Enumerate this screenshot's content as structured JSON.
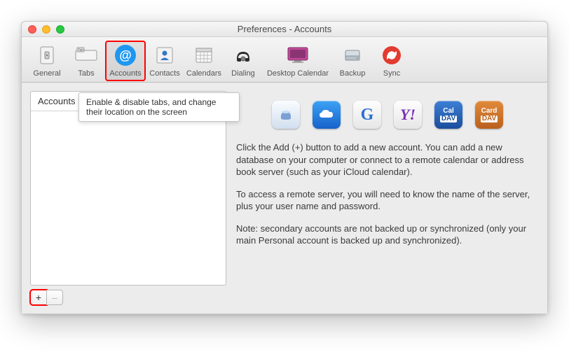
{
  "window": {
    "title": "Preferences - Accounts"
  },
  "toolbar": {
    "items": [
      {
        "label": "General"
      },
      {
        "label": "Tabs"
      },
      {
        "label": "Accounts"
      },
      {
        "label": "Contacts"
      },
      {
        "label": "Calendars"
      },
      {
        "label": "Dialing"
      },
      {
        "label": "Desktop Calendar"
      },
      {
        "label": "Backup"
      },
      {
        "label": "Sync"
      }
    ]
  },
  "sidebar": {
    "header": "Accounts",
    "tooltip": "Enable & disable tabs, and change their location on the screen",
    "add_label": "+",
    "remove_label": "–"
  },
  "services": [
    {
      "name": "apple"
    },
    {
      "name": "icloud"
    },
    {
      "name": "google"
    },
    {
      "name": "yahoo"
    },
    {
      "name": "caldav",
      "top": "Cal",
      "bottom": "DAV"
    },
    {
      "name": "carddav",
      "top": "Card",
      "bottom": "DAV"
    }
  ],
  "info": {
    "p1": "Click the Add (+) button to add a new account. You can add a new database on your computer or connect to a remote calendar or address book server (such as your iCloud calendar).",
    "p2": "To access a remote server, you will need to know the name of the server, plus your user name and password.",
    "p3": "Note: secondary accounts are not backed up or synchronized (only your main Personal account is backed up and synchronized)."
  }
}
